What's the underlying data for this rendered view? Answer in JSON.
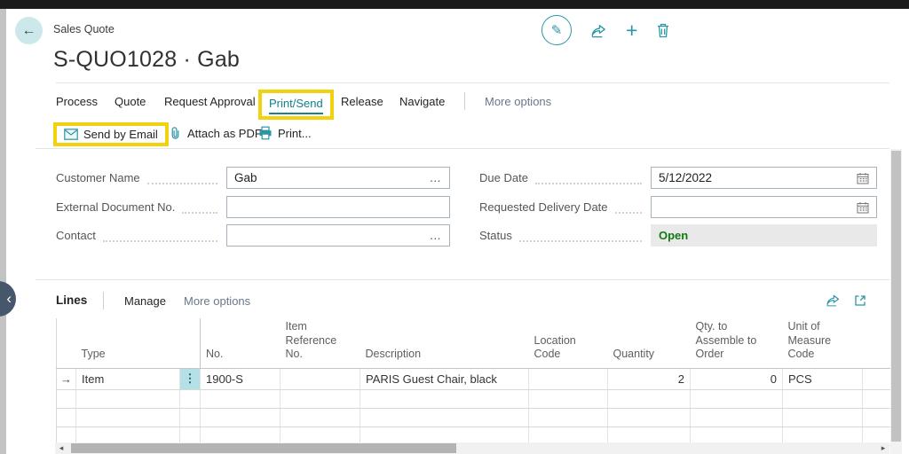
{
  "colors": {
    "accent_teal": "#2a96a4",
    "highlight_yellow": "#f2d10e",
    "status_green": "#107c10",
    "muted_link": "#68778a"
  },
  "page": {
    "breadcrumb": "Sales Quote",
    "title": "S-QUO1028 · Gab"
  },
  "system_actions": {
    "icons": [
      "edit",
      "share",
      "add",
      "delete"
    ]
  },
  "ribbon": {
    "tabs": [
      "Process",
      "Quote",
      "Request Approval",
      "Print/Send",
      "Release",
      "Navigate"
    ],
    "active_tab": "Print/Send",
    "more_label": "More options"
  },
  "action_bar": {
    "items": [
      {
        "label": "Send by Email",
        "icon": "email-icon",
        "highlighted": true
      },
      {
        "label": "Attach as PDF",
        "icon": "attach-pdf-icon"
      },
      {
        "label": "Print...",
        "icon": "printer-icon"
      }
    ]
  },
  "form": {
    "left": [
      {
        "label": "Customer Name",
        "value": "Gab",
        "lookup": "…"
      },
      {
        "label": "External Document No.",
        "value": ""
      },
      {
        "label": "Contact",
        "value": "",
        "lookup": "…"
      }
    ],
    "right": [
      {
        "label": "Due Date",
        "value": "5/12/2022",
        "icon": "calendar-icon"
      },
      {
        "label": "Requested Delivery Date",
        "value": "",
        "icon": "calendar-icon"
      },
      {
        "label": "Status",
        "value": "Open",
        "readonly": true
      }
    ]
  },
  "lines": {
    "title": "Lines",
    "menu": [
      "Manage"
    ],
    "more_label": "More options",
    "icons": [
      "share",
      "expand"
    ],
    "columns": [
      "Type",
      "No.",
      "Item Reference No.",
      "Description",
      "Location Code",
      "Quantity",
      "Qty. to Assemble to Order",
      "Unit of Measure Code"
    ],
    "row": {
      "type": "Item",
      "no": "1900-S",
      "item_reference_no": "",
      "description": "PARIS Guest Chair, black",
      "location_code": "",
      "quantity": "2",
      "qty_to_assemble_to_order": "0",
      "unit_of_measure_code": "PCS"
    },
    "empty_row_count": 3
  },
  "glyphs": {
    "back": "←",
    "chevron_left": "‹",
    "pencil": "✎",
    "plus": "+",
    "email": "✉",
    "row_arrow": "→",
    "dots": "⋮",
    "lookup": "…",
    "scroll_left": "◂",
    "scroll_right": "▸"
  }
}
